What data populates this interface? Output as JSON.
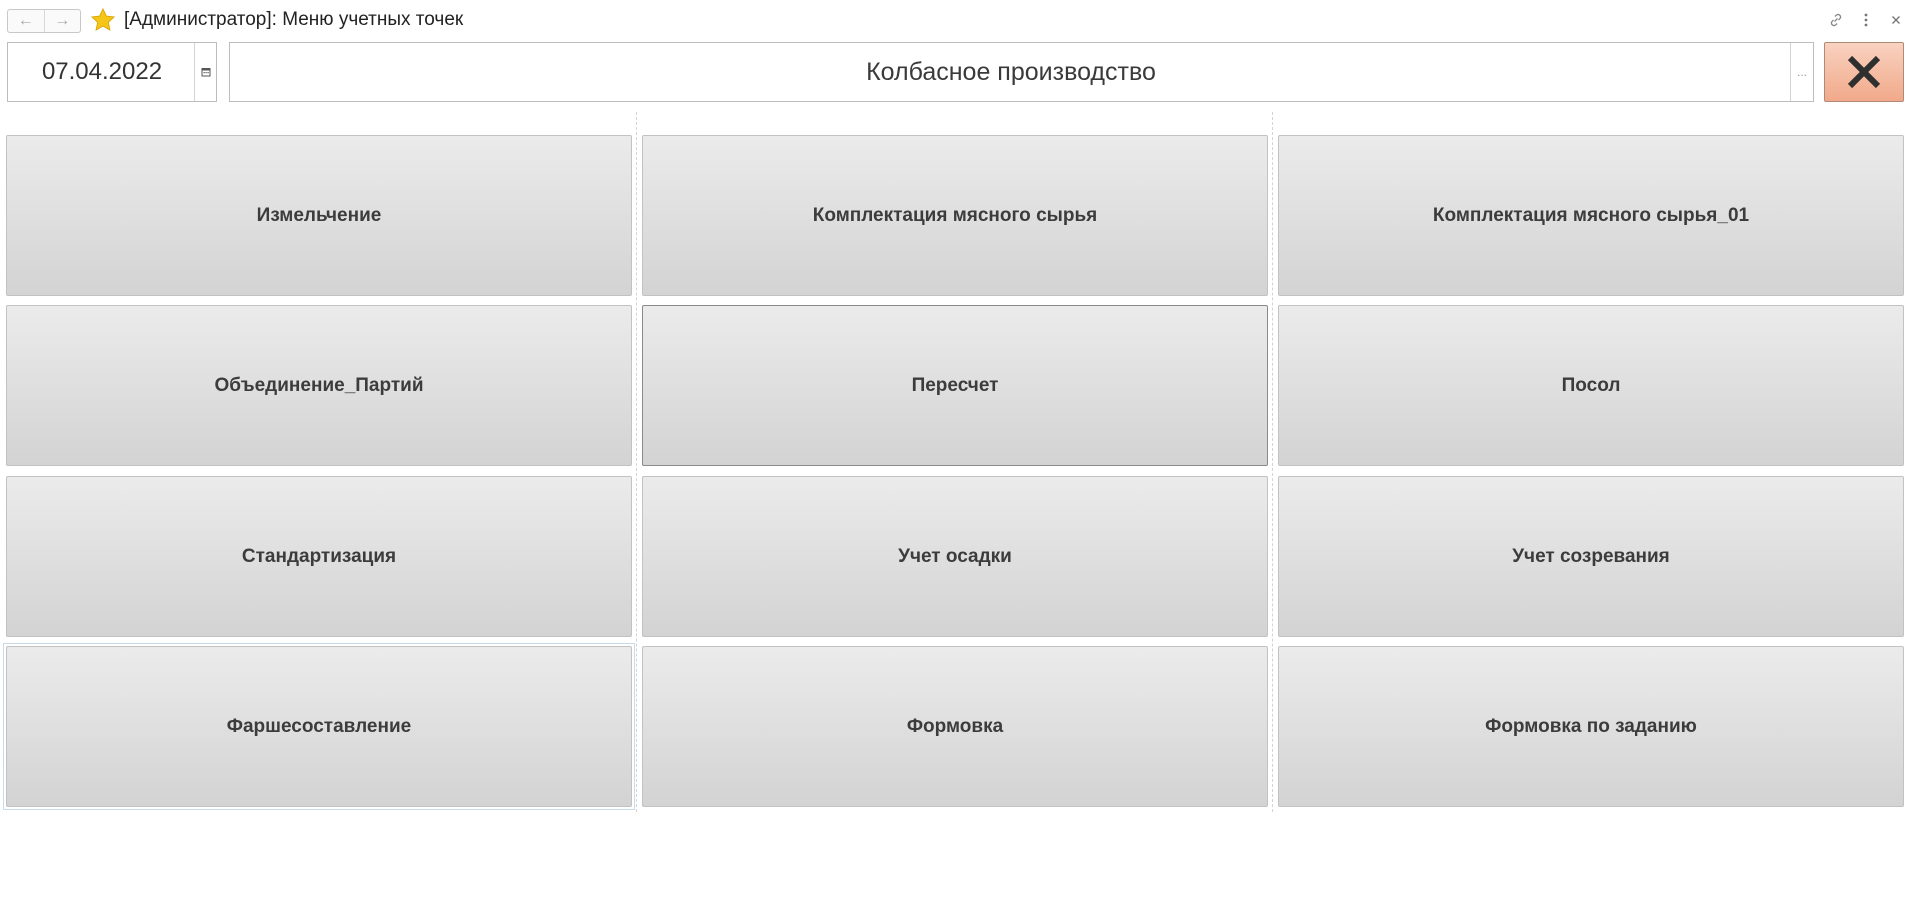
{
  "window": {
    "title": "[Администратор]: Меню учетных точек"
  },
  "date_field": {
    "value": "07.04.2022"
  },
  "production_field": {
    "value": "Колбасное производство",
    "select_label": "..."
  },
  "buttons": [
    "Измельчение",
    "Комплектация мясного сырья",
    "Комплектация мясного сырья_01",
    "Объединение_Партий",
    "Пересчет",
    "Посол",
    "Стандартизация",
    "Учет осадки",
    "Учет созревания",
    "Фаршесоставление",
    "Формовка",
    "Формовка по заданию"
  ],
  "colors": {
    "close_button": "#f4b49a",
    "star": "#f5c518",
    "tile": "#dcdcdc"
  }
}
